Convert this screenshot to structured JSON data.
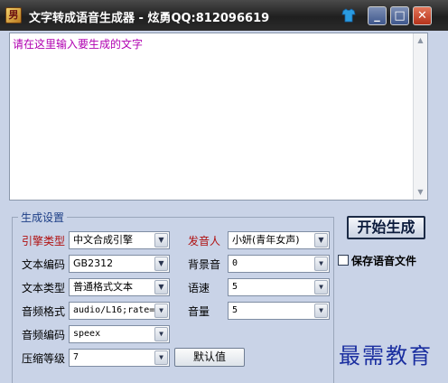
{
  "window": {
    "title": "文字转成语音生成器 - 炫勇QQ:812096619",
    "app_icon_char": "男",
    "icons": {
      "app": "app-logo-icon",
      "skin": "skin-shirt-icon",
      "minimize": "minimize-icon",
      "maximize": "maximize-icon",
      "close": "close-icon"
    },
    "minimize_glyph": "_",
    "maximize_glyph": "□",
    "close_glyph": "✕"
  },
  "editor": {
    "placeholder": "请在这里输入要生成的文字"
  },
  "settings": {
    "group_title": "生成设置",
    "engine": {
      "label": "引擎类型",
      "value": "中文合成引擎"
    },
    "encoding": {
      "label": "文本编码",
      "value": "GB2312"
    },
    "text_type": {
      "label": "文本类型",
      "value": "普通格式文本"
    },
    "audio_format": {
      "label": "音频格式",
      "value": "audio/L16;rate="
    },
    "audio_codec": {
      "label": "音频编码",
      "value": "speex"
    },
    "compression": {
      "label": "压缩等级",
      "value": "7"
    },
    "speaker": {
      "label": "发音人",
      "value": "小妍(青年女声)"
    },
    "bg_sound": {
      "label": "背景音",
      "value": "0"
    },
    "speed": {
      "label": "语速",
      "value": "5"
    },
    "volume": {
      "label": "音量",
      "value": "5"
    },
    "default_button": "默认值"
  },
  "actions": {
    "start_button": "开始生成",
    "save_checkbox_label": "保存语音文件",
    "save_checked": false
  },
  "watermark": "最需教育",
  "colors": {
    "accent_label": "#b01010",
    "placeholder": "#b000b0",
    "group_title": "#1c3e86",
    "watermark": "#1b2fa0",
    "background": "#c9d3e7"
  }
}
